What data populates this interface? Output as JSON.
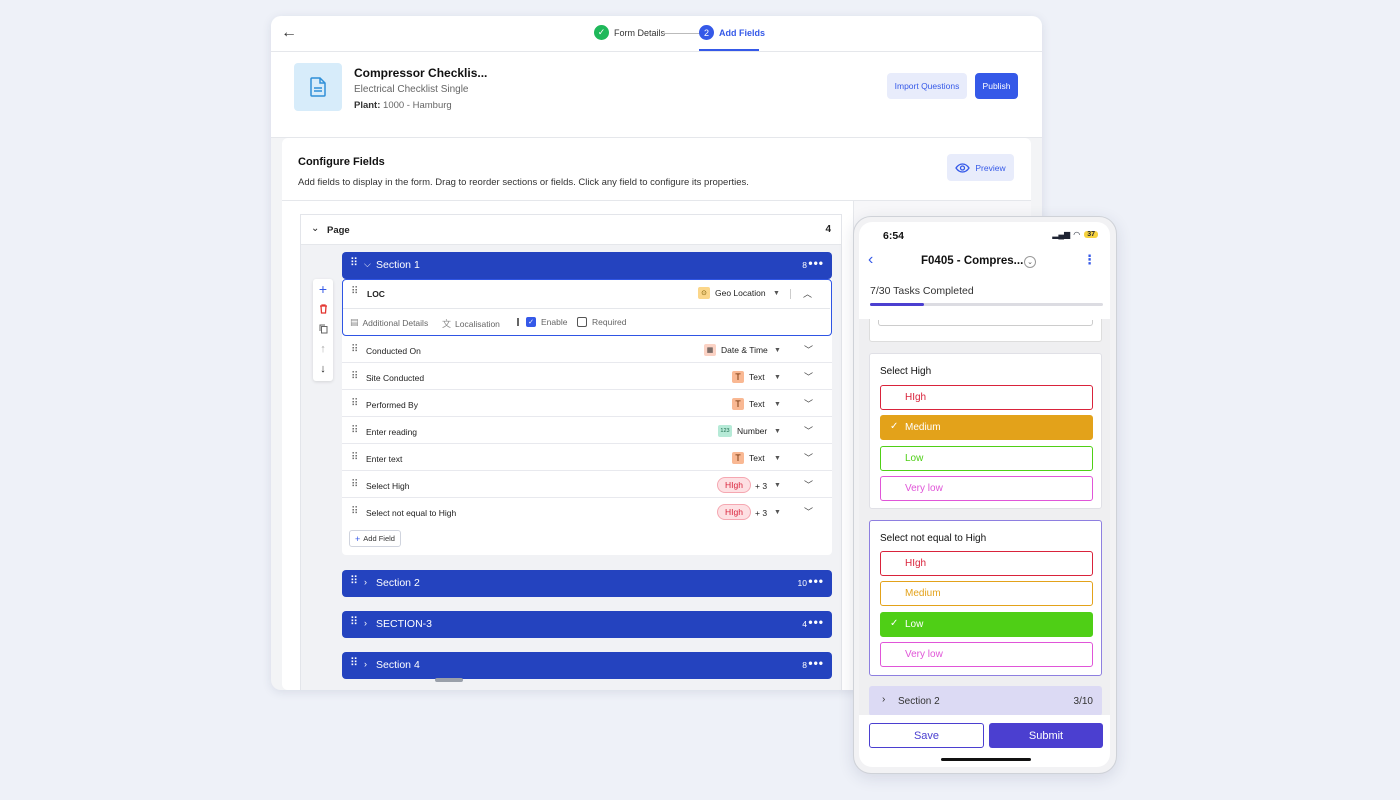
{
  "stepper": {
    "step1": {
      "number": "✓",
      "label": "Form Details"
    },
    "step2": {
      "number": "2",
      "label": "Add Fields"
    }
  },
  "form": {
    "title": "Compressor Checklis...",
    "subtitle": "Electrical Checklist Single",
    "plant_label": "Plant:",
    "plant_value": " 1000 - Hamburg",
    "import_label": "Import Questions",
    "publish_label": "Publish"
  },
  "config": {
    "title": "Configure Fields",
    "description": "Add fields to display in the form. Drag to reorder sections or fields. Click any field to configure its properties.",
    "preview_label": "Preview"
  },
  "page": {
    "label": "Page",
    "count": "4"
  },
  "sections": [
    {
      "name": "Section 1",
      "count": "8",
      "expanded": true
    },
    {
      "name": "Section 2",
      "count": "10",
      "expanded": false
    },
    {
      "name": "SECTION-3",
      "count": "4",
      "expanded": false
    },
    {
      "name": "Section 4",
      "count": "8",
      "expanded": false
    }
  ],
  "loc_field": {
    "name": "LOC",
    "type": "Geo Location",
    "options": {
      "additional_details": "Additional Details",
      "localisation": "Localisation",
      "enable": "Enable",
      "required": "Required"
    },
    "enable_checked": true,
    "required_checked": false
  },
  "fields": [
    {
      "name": "Conducted On",
      "type": "Date & Time",
      "icon": "calendar-icon"
    },
    {
      "name": "Site Conducted",
      "type": "Text",
      "icon": "T"
    },
    {
      "name": "Performed By",
      "type": "Text",
      "icon": "T"
    },
    {
      "name": "Enter reading",
      "type": "Number",
      "icon": "123"
    },
    {
      "name": "Enter text",
      "type": "Text",
      "icon": "T"
    },
    {
      "name": "Select High",
      "pill": "HIgh",
      "more": "+ 3"
    },
    {
      "name": "Select not equal to High",
      "pill": "HIgh",
      "more": "+ 3"
    }
  ],
  "add_field_label": "Add Field",
  "phone": {
    "time": "6:54",
    "battery": "37",
    "title": "F0405 - Compres...",
    "tasks": "7/30 Tasks Completed",
    "progress": 0.233,
    "question1": {
      "title": "Select High",
      "options": [
        {
          "label": "HIgh",
          "color": "#d9233b",
          "selected": false
        },
        {
          "label": "Medium",
          "color": "#e3a21a",
          "selected": true
        },
        {
          "label": "Low",
          "color": "#4fcf16",
          "selected": false
        },
        {
          "label": "Very low",
          "color": "#e055d8",
          "selected": false
        }
      ]
    },
    "question2": {
      "title": "Select not equal to High",
      "options": [
        {
          "label": "HIgh",
          "color": "#d9233b",
          "selected": false
        },
        {
          "label": "Medium",
          "color": "#e3a21a",
          "selected": false
        },
        {
          "label": "Low",
          "color": "#4fcf16",
          "selected": true
        },
        {
          "label": "Very low",
          "color": "#e055d8",
          "selected": false
        }
      ]
    },
    "section2": {
      "name": "Section 2",
      "count": "3/10"
    },
    "save_label": "Save",
    "submit_label": "Submit"
  }
}
